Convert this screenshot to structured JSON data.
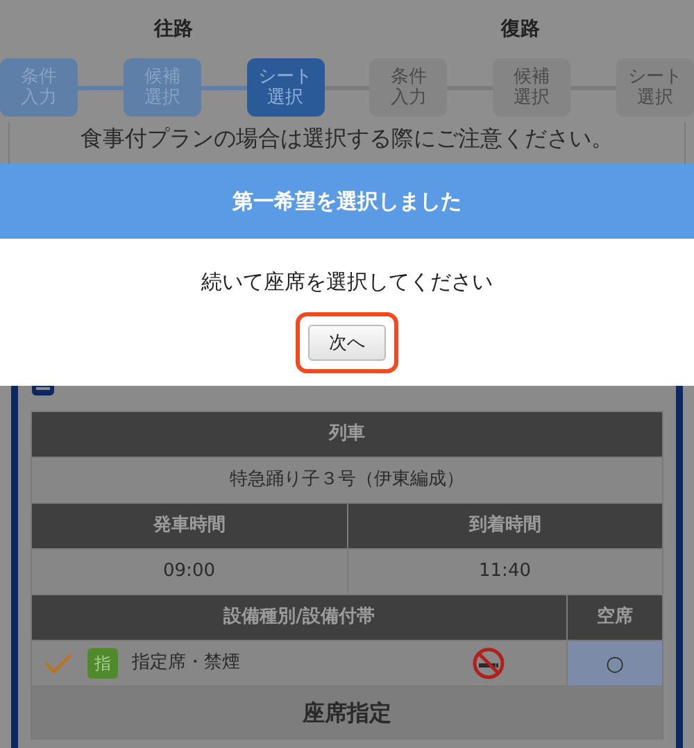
{
  "legs": [
    {
      "label": "往路",
      "steps": [
        {
          "lines": [
            "条件",
            "入力"
          ],
          "completed": true,
          "selected": false
        },
        {
          "lines": [
            "候補",
            "選択"
          ],
          "completed": true,
          "selected": false
        },
        {
          "lines": [
            "シート",
            "選択"
          ],
          "completed": false,
          "selected": true
        }
      ]
    },
    {
      "label": "復路",
      "steps": [
        {
          "lines": [
            "条件",
            "入力"
          ],
          "completed": false,
          "selected": false
        },
        {
          "lines": [
            "候補",
            "選択"
          ],
          "completed": false,
          "selected": false
        },
        {
          "lines": [
            "シート",
            "選択"
          ],
          "completed": false,
          "selected": false
        }
      ]
    }
  ],
  "notice": "食事付プランの場合は選択する際にご注意ください。",
  "modal": {
    "title": "第一希望を選択しました",
    "message": "続いて座席を選択してください",
    "button": {
      "label": "次へ",
      "highlighted": true
    }
  },
  "train_table": {
    "train_header": "列車",
    "train_name": "特急踊り子３号（伊東編成）",
    "departure_header": "発車時間",
    "arrival_header": "到着時間",
    "departure": "09:00",
    "arrival": "11:40",
    "facility_header": "設備種別/設備付帯",
    "vacancy_header": "空席",
    "rows": [
      {
        "checked": true,
        "badge": "指",
        "facility": "指定席・禁煙",
        "no_smoking": true,
        "vacancy": "○"
      }
    ]
  },
  "seat_button": "座席指定"
}
